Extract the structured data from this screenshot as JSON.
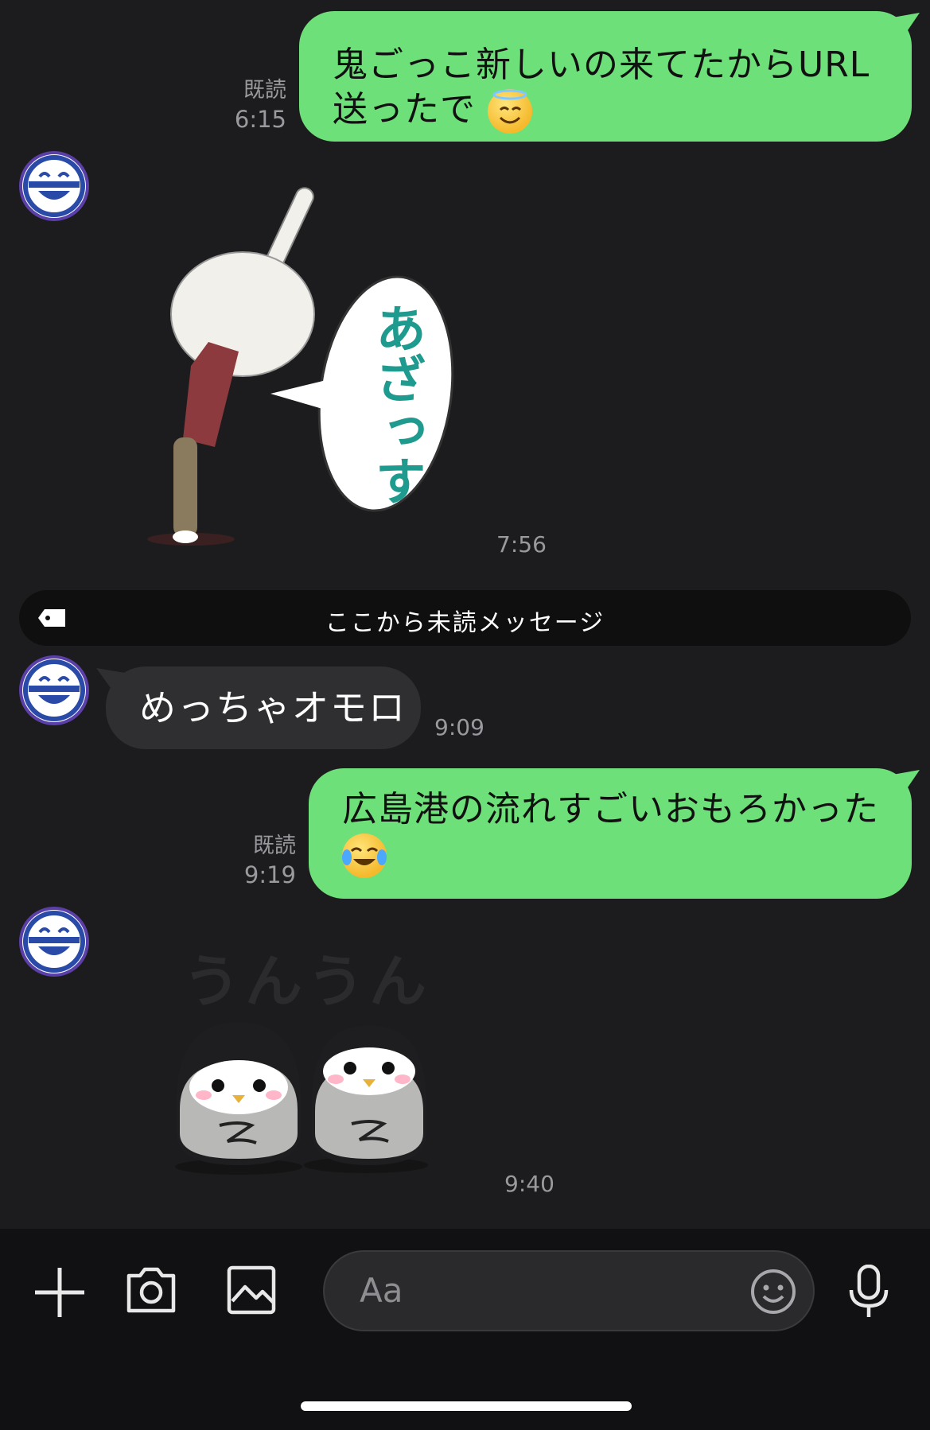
{
  "messages": [
    {
      "id": "m1",
      "direction": "out",
      "line1": "鬼ごっこ新しいの来てたからURL",
      "line2": "送ったで",
      "emoji": "smiling-face-with-halo-emoji",
      "read_label": "既読",
      "time": "6:15"
    },
    {
      "id": "m2",
      "direction": "in",
      "type": "sticker",
      "sticker_text": "あざっす",
      "time": "7:56"
    },
    {
      "id": "m3",
      "direction": "in",
      "text": "めっちゃオモロ",
      "time": "9:09"
    },
    {
      "id": "m4",
      "direction": "out",
      "line1": "広島港の流れすごいおもろかった",
      "emoji": "face-with-tears-of-joy-emoji",
      "read_label": "既読",
      "time": "9:19"
    },
    {
      "id": "m5",
      "direction": "in",
      "type": "sticker",
      "sticker_text": "うんうん",
      "time": "9:40"
    }
  ],
  "unread_divider": {
    "label": "ここから未読メッセージ"
  },
  "composer": {
    "placeholder": "Aa"
  },
  "icons": [
    "plus-icon",
    "camera-icon",
    "image-icon",
    "emoji-icon",
    "microphone-icon",
    "tag-icon"
  ],
  "colors": {
    "outgoing_bubble": "#6ee07a",
    "incoming_bubble": "#2f2f31",
    "background": "#1c1c1e",
    "meta_text": "#9a9a9e"
  }
}
